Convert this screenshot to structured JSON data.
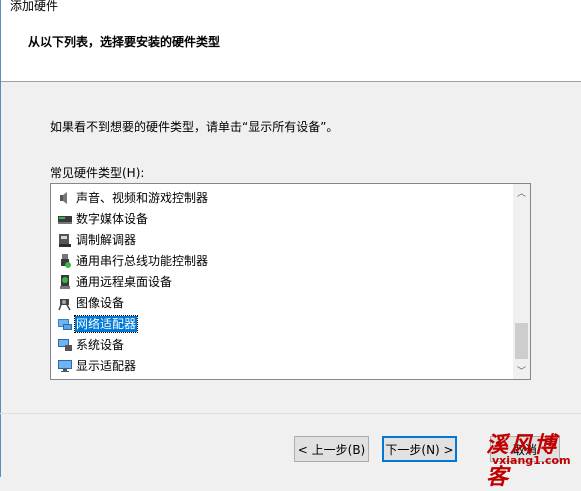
{
  "window": {
    "title": "添加硬件"
  },
  "header": {
    "title": "从以下列表，选择要安装的硬件类型"
  },
  "hint": "如果看不到想要的硬件类型，请单击“显示所有设备”。",
  "list_label": "常见硬件类型(H):",
  "items": [
    {
      "label": "声音、视频和游戏控制器",
      "icon": "speaker-icon"
    },
    {
      "label": "数字媒体设备",
      "icon": "media-device-icon"
    },
    {
      "label": "调制解调器",
      "icon": "modem-icon"
    },
    {
      "label": "通用串行总线功能控制器",
      "icon": "usb-icon"
    },
    {
      "label": "通用远程桌面设备",
      "icon": "remote-desktop-icon"
    },
    {
      "label": "图像设备",
      "icon": "camera-icon"
    },
    {
      "label": "网络适配器",
      "icon": "network-adapter-icon",
      "selected": true
    },
    {
      "label": "系统设备",
      "icon": "system-device-icon"
    },
    {
      "label": "显示适配器",
      "icon": "display-adapter-icon"
    }
  ],
  "buttons": {
    "back": "< 上一步(B)",
    "next": "下一步(N) >",
    "cancel": "取消"
  },
  "watermark": {
    "text": "溪风博客",
    "url": "vxiang1.com"
  },
  "colors": {
    "selection": "#0078d7",
    "watermark": "#c00000"
  }
}
